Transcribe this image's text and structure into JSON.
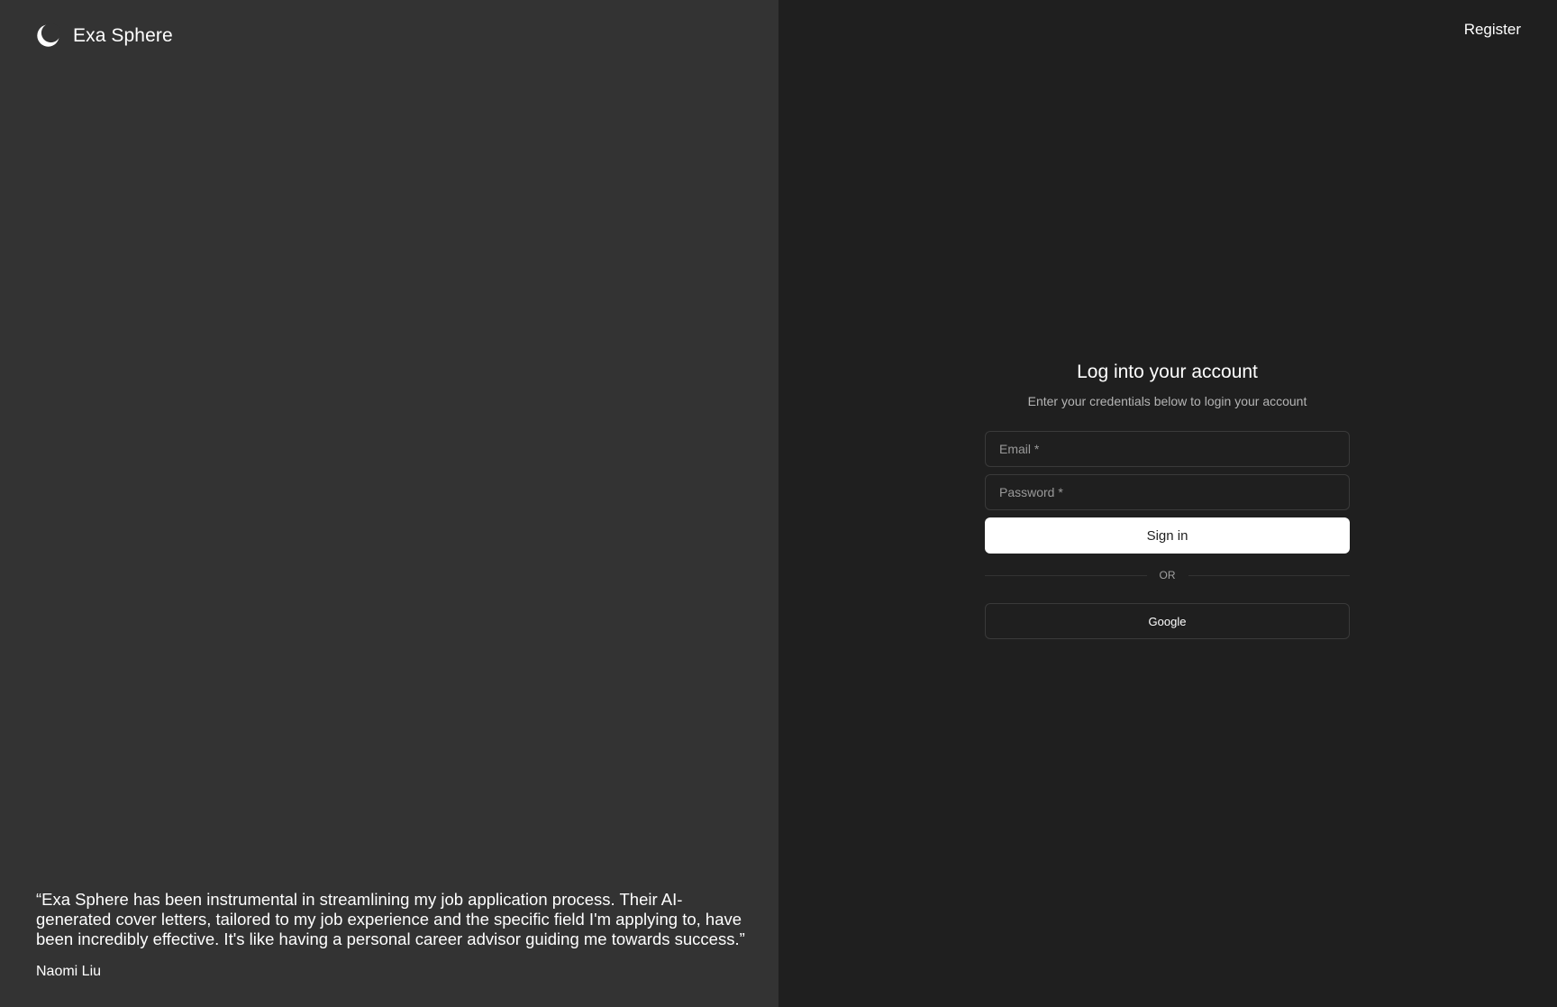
{
  "brand": {
    "name": "Exa Sphere",
    "logo_icon": "crescent-moon-icon"
  },
  "testimonial": {
    "quote": "“Exa Sphere has been instrumental in streamlining my job application process. Their AI-generated cover letters, tailored to my job experience and the specific field I'm applying to, have been incredibly effective. It's like having a personal career advisor guiding me towards success.”",
    "author": "Naomi Liu"
  },
  "header": {
    "register_label": "Register"
  },
  "login": {
    "title": "Log into your account",
    "subtitle": "Enter your credentials below to login your account",
    "email_placeholder": "Email *",
    "password_placeholder": "Password *",
    "signin_label": "Sign in",
    "divider_label": "OR",
    "google_label": "Google"
  },
  "colors": {
    "left_panel_bg": "#333333",
    "right_panel_bg": "#1f1f1f",
    "primary_button_bg": "#ffffff",
    "text": "#ffffff"
  }
}
